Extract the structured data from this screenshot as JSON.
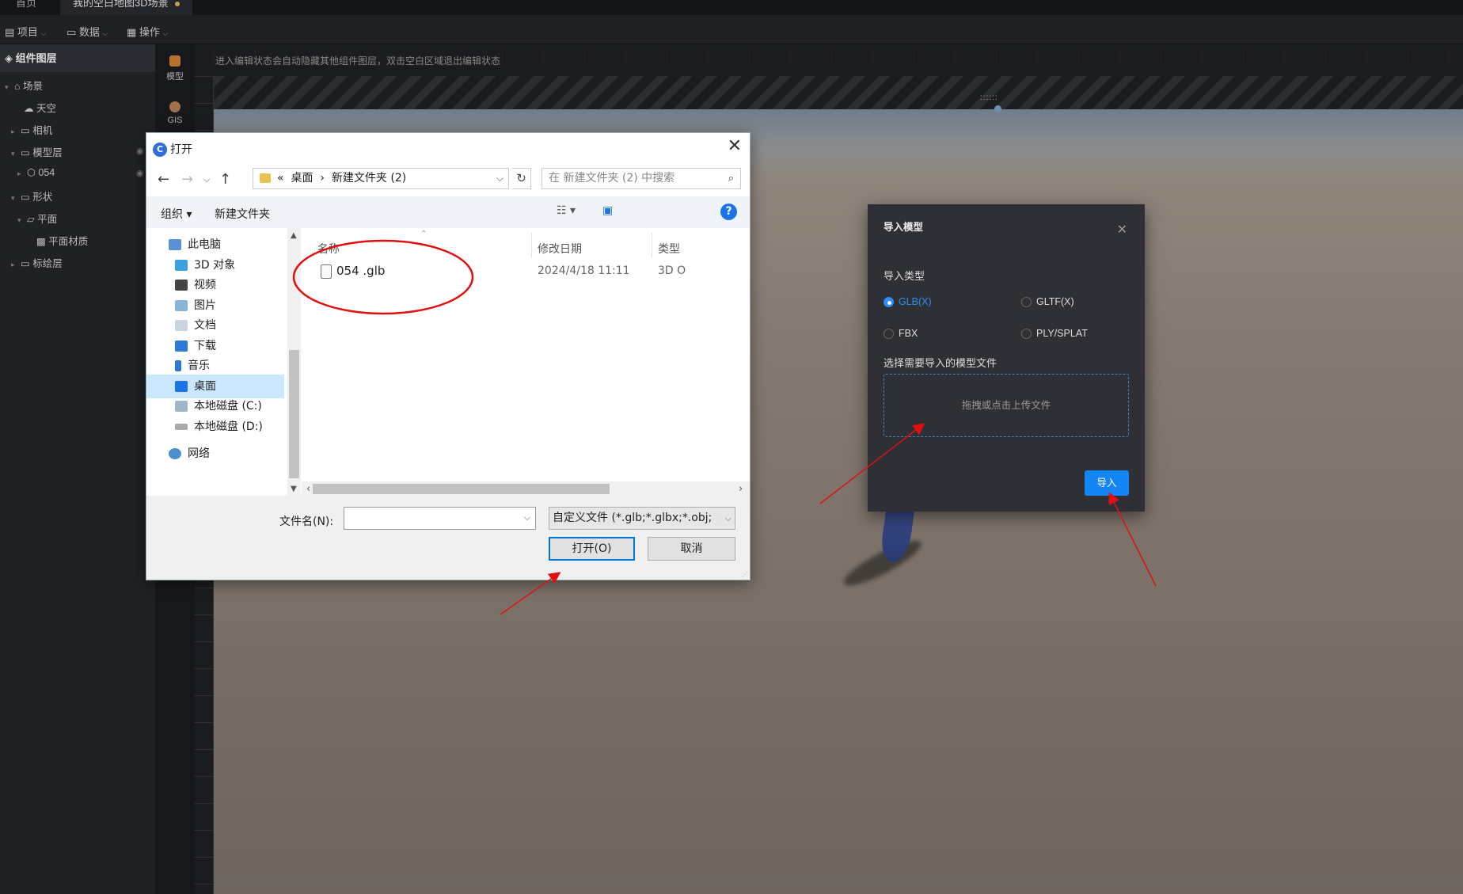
{
  "tabs": [
    {
      "label": "首页"
    },
    {
      "label": "我的空白地图3D场景",
      "modified": true
    }
  ],
  "menubar": {
    "project": "项目",
    "data": "数据",
    "ops": "操作"
  },
  "sidebar": {
    "title": "组件图层",
    "items": [
      {
        "label": "场景"
      },
      {
        "label": "天空"
      },
      {
        "label": "相机"
      },
      {
        "label": "模型层"
      },
      {
        "label": "054"
      },
      {
        "label": "形状"
      },
      {
        "label": "平面"
      },
      {
        "label": "平面材质"
      },
      {
        "label": "标绘层"
      }
    ]
  },
  "iconstrip": {
    "model": "模型",
    "gis": "GIS"
  },
  "canvas": {
    "hint": "进入编辑状态会自动隐藏其他组件图层，双击空白区域退出编辑状态"
  },
  "file_dialog": {
    "title": "打开",
    "address": {
      "prefix": "«",
      "crumb1": "桌面",
      "sep": "›",
      "crumb2": "新建文件夹 (2)"
    },
    "search_placeholder": "在 新建文件夹 (2) 中搜索",
    "organize": "组织 ▾",
    "new_folder": "新建文件夹",
    "nav": [
      {
        "label": "此电脑"
      },
      {
        "label": "3D 对象"
      },
      {
        "label": "视频"
      },
      {
        "label": "图片"
      },
      {
        "label": "文档"
      },
      {
        "label": "下载"
      },
      {
        "label": "音乐"
      },
      {
        "label": "桌面",
        "selected": true
      },
      {
        "label": "本地磁盘 (C:)"
      },
      {
        "label": "本地磁盘 (D:)"
      },
      {
        "label": "网络"
      }
    ],
    "columns": {
      "name": "名称",
      "modified": "修改日期",
      "type": "类型"
    },
    "files": [
      {
        "name": "054 .glb",
        "modified": "2024/4/18 11:11",
        "type": "3D O"
      }
    ],
    "filename_label": "文件名(N):",
    "filename_value": "",
    "filter": "自定义文件 (*.glb;*.glbx;*.obj;",
    "open_button": "打开(O)",
    "cancel_button": "取消"
  },
  "import_modal": {
    "title": "导入模型",
    "type_label": "导入类型",
    "options": [
      {
        "label": "GLB(X)",
        "checked": true
      },
      {
        "label": "GLTF(X)",
        "checked": false
      },
      {
        "label": "FBX",
        "checked": false
      },
      {
        "label": "PLY/SPLAT",
        "checked": false
      }
    ],
    "file_label": "选择需要导入的模型文件",
    "dropzone_text": "拖拽或点击上传文件",
    "import_button": "导入"
  },
  "annotation_color": "#e01010"
}
